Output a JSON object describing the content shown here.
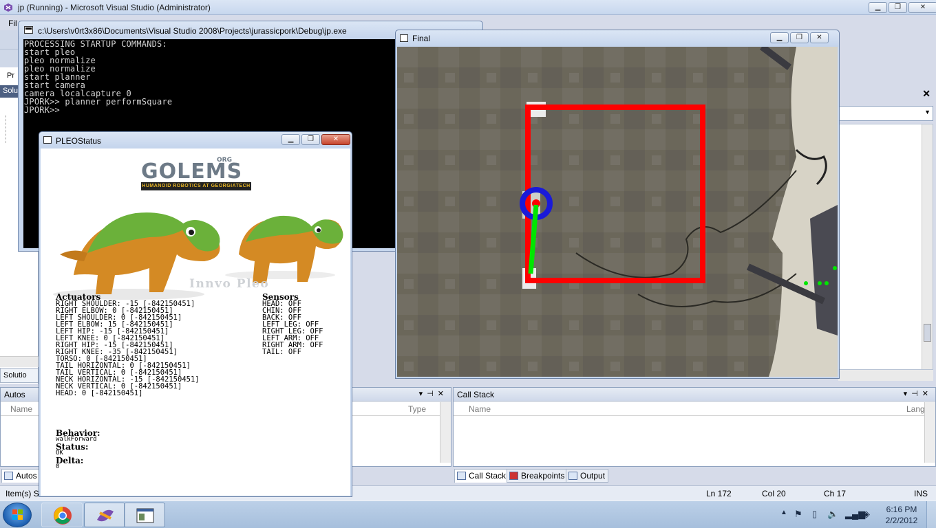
{
  "vs": {
    "title": "jp (Running) - Microsoft Visual Studio (Administrator)",
    "menu_first": "Fil",
    "left_pane_label": "Pr",
    "left_pane_header": "Solu",
    "solution_tab": "Solutio"
  },
  "console": {
    "title": "c:\\Users\\v0rt3x86\\Documents\\Visual Studio 2008\\Projects\\jurassicpork\\Debug\\jp.exe",
    "lines": "PROCESSING STARTUP COMMANDS:\nstart pleo\npleo normalize\npleo normalize\nstart planner\nstart camera\ncamera localcapture 0\nJPORK>> planner performSquare\nJPORK>>"
  },
  "pleo": {
    "title": "PLEOStatus",
    "logo_text": "GOLEMS",
    "logo_org": "ORG",
    "logo_sub": "HUMANOID ROBOTICS AT GEORGIATECH",
    "watermark": "Innvo Pleo",
    "actuators_heading": "Actuators",
    "actuators": "RIGHT SHOULDER: -15 [-842150451]\nRIGHT ELBOW: 0 [-842150451]\nLEFT SHOULDER: 0 [-842150451]\nLEFT ELBOW: 15 [-842150451]\nLEFT HIP: -15 [-842150451]\nLEFT KNEE: 0 [-842150451]\nRIGHT HIP: -15 [-842150451]\nRIGHT KNEE: -35 [-842150451]\nTORSO: 0 [-842150451]\nTAIL HORIZONTAL: 0 [-842150451]\nTAIL VERTICAL: 0 [-842150451]\nNECK HORIZONTAL: -15 [-842150451]\nNECK VERTICAL: 0 [-842150451]\nHEAD: 0 [-842150451]",
    "sensors_heading": "Sensors",
    "sensors": "HEAD: OFF\nCHIN: OFF\nBACK: OFF\nLEFT LEG: OFF\nRIGHT LEG: OFF\nLEFT ARM: OFF\nRIGHT ARM: OFF\nTAIL: OFF",
    "behavior_heading": "Behavior:",
    "behavior_value": "walkForward",
    "status_heading": "Status:",
    "status_value": "OK",
    "delta_heading": "Delta:",
    "delta_value": "0"
  },
  "final": {
    "title": "Final"
  },
  "autos": {
    "title": "Autos",
    "col_name": "Name",
    "col_type": "Type",
    "tab_label": "Autos"
  },
  "callstack": {
    "title": "Call Stack",
    "col_name": "Name",
    "col_lang": "Lang"
  },
  "bottom_tabs": {
    "callstack": "Call Stack",
    "breakpoints": "Breakpoints",
    "output": "Output"
  },
  "statusbar": {
    "left": "Item(s) S",
    "ln": "Ln 172",
    "col": "Col 20",
    "ch": "Ch 17",
    "mode": "INS"
  },
  "taskbar": {
    "time": "6:16 PM",
    "date": "2/2/2012"
  },
  "colors": {
    "trace_red": "#ff0000",
    "trace_green": "#00e600",
    "ring_blue": "#1a1ad9",
    "carpet": "#6e6a5c"
  }
}
